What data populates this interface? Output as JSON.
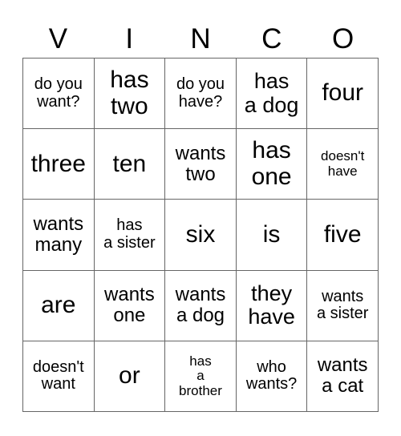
{
  "card": {
    "header": {
      "letters": [
        "V",
        "I",
        "N",
        "C",
        "O"
      ]
    },
    "grid": {
      "rows": 5,
      "columns": 5,
      "border_color": "#666666",
      "text_color": "#000000",
      "background_color": "#ffffff",
      "cells": [
        {
          "text": "do you\nwant?",
          "size": "sm"
        },
        {
          "text": "has\ntwo",
          "size": "xl"
        },
        {
          "text": "do you\nhave?",
          "size": "sm"
        },
        {
          "text": "has\na dog",
          "size": "lg"
        },
        {
          "text": "four",
          "size": "xl"
        },
        {
          "text": "three",
          "size": "xl"
        },
        {
          "text": "ten",
          "size": "xl"
        },
        {
          "text": "wants\ntwo",
          "size": "md"
        },
        {
          "text": "has\none",
          "size": "xl"
        },
        {
          "text": "doesn't\nhave",
          "size": "xs"
        },
        {
          "text": "wants\nmany",
          "size": "md"
        },
        {
          "text": "has\na sister",
          "size": "sm"
        },
        {
          "text": "six",
          "size": "xl"
        },
        {
          "text": "is",
          "size": "xl"
        },
        {
          "text": "five",
          "size": "xl"
        },
        {
          "text": "are",
          "size": "xl"
        },
        {
          "text": "wants\none",
          "size": "md"
        },
        {
          "text": "wants\na dog",
          "size": "md"
        },
        {
          "text": "they\nhave",
          "size": "lg"
        },
        {
          "text": "wants\na sister",
          "size": "sm"
        },
        {
          "text": "doesn't\nwant",
          "size": "sm"
        },
        {
          "text": "or",
          "size": "xl"
        },
        {
          "text": "has\na\nbrother",
          "size": "xs"
        },
        {
          "text": "who\nwants?",
          "size": "sm"
        },
        {
          "text": "wants\na cat",
          "size": "md"
        }
      ]
    }
  }
}
